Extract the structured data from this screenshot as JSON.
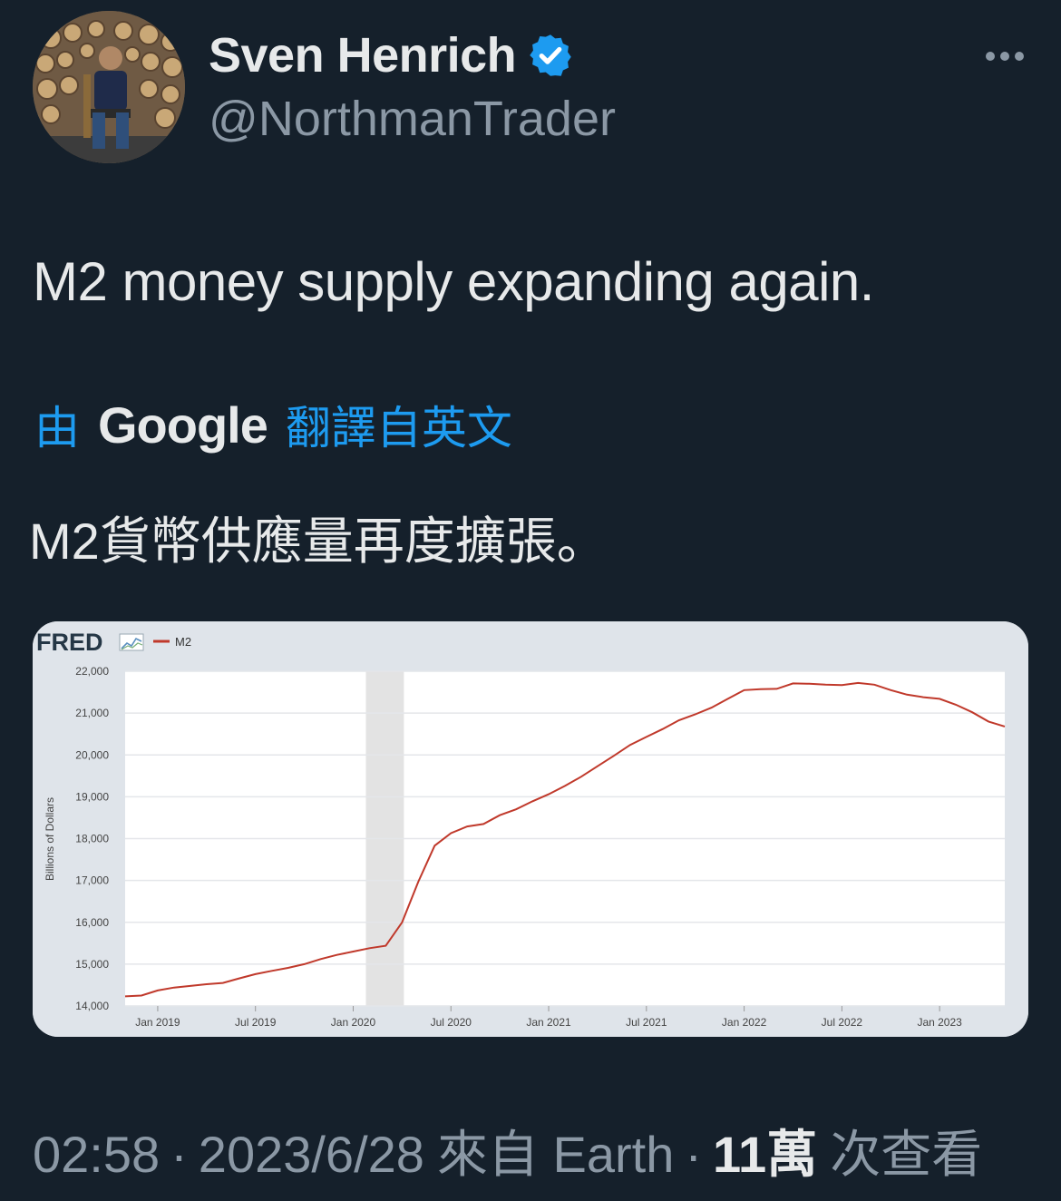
{
  "author": {
    "display_name": "Sven Henrich",
    "handle": "@NorthmanTrader",
    "verified": true
  },
  "icons": {
    "verified": "verified-badge-icon",
    "more": "more-options-icon"
  },
  "tweet": {
    "text": "M2 money supply expanding again.",
    "translation_prefix": "由",
    "translation_brand": "Google",
    "translation_suffix": "翻譯自英文",
    "translated_text": "M2貨幣供應量再度擴張。"
  },
  "meta": {
    "time": "02:58",
    "date": "2023/6/28",
    "source": "來自 Earth",
    "views_count": "11萬",
    "views_label": "次查看"
  },
  "colors": {
    "background": "#15202b",
    "accent": "#1d9bf0",
    "secondary_text": "#8b98a5",
    "series_line": "#c0392b"
  },
  "chart_data": {
    "type": "line",
    "source_logo": "FRED",
    "legend": [
      "M2"
    ],
    "ylabel": "Billions of Dollars",
    "xlabel": "",
    "ylim": [
      14000,
      22000
    ],
    "yticks": [
      "14,000",
      "15,000",
      "16,000",
      "17,000",
      "18,000",
      "19,000",
      "20,000",
      "21,000",
      "22,000"
    ],
    "xticks": [
      "Jan 2019",
      "Jul 2019",
      "Jan 2020",
      "Jul 2020",
      "Jan 2021",
      "Jul 2021",
      "Jan 2022",
      "Jul 2022",
      "Jan 2023"
    ],
    "x_range": [
      "2018-11",
      "2023-05"
    ],
    "recession_shading": [
      "2020-02",
      "2020-04"
    ],
    "grid": true,
    "series": [
      {
        "name": "M2",
        "x": [
          "2018-11",
          "2018-12",
          "2019-01",
          "2019-02",
          "2019-03",
          "2019-04",
          "2019-05",
          "2019-06",
          "2019-07",
          "2019-08",
          "2019-09",
          "2019-10",
          "2019-11",
          "2019-12",
          "2020-01",
          "2020-02",
          "2020-03",
          "2020-04",
          "2020-05",
          "2020-06",
          "2020-07",
          "2020-08",
          "2020-09",
          "2020-10",
          "2020-11",
          "2020-12",
          "2021-01",
          "2021-02",
          "2021-03",
          "2021-04",
          "2021-05",
          "2021-06",
          "2021-07",
          "2021-08",
          "2021-09",
          "2021-10",
          "2021-11",
          "2021-12",
          "2022-01",
          "2022-02",
          "2022-03",
          "2022-04",
          "2022-05",
          "2022-06",
          "2022-07",
          "2022-08",
          "2022-09",
          "2022-10",
          "2022-11",
          "2022-12",
          "2023-01",
          "2023-02",
          "2023-03",
          "2023-04",
          "2023-05"
        ],
        "values": [
          14230,
          14250,
          14370,
          14440,
          14480,
          14520,
          14550,
          14660,
          14760,
          14840,
          14910,
          15000,
          15120,
          15220,
          15300,
          15380,
          15440,
          16000,
          16970,
          17830,
          18130,
          18290,
          18350,
          18560,
          18700,
          18890,
          19060,
          19260,
          19480,
          19730,
          19980,
          20240,
          20430,
          20620,
          20830,
          20970,
          21130,
          21340,
          21550,
          21570,
          21580,
          21710,
          21700,
          21680,
          21670,
          21720,
          21680,
          21550,
          21440,
          21380,
          21340,
          21200,
          21020,
          20800,
          20680
        ]
      }
    ]
  }
}
